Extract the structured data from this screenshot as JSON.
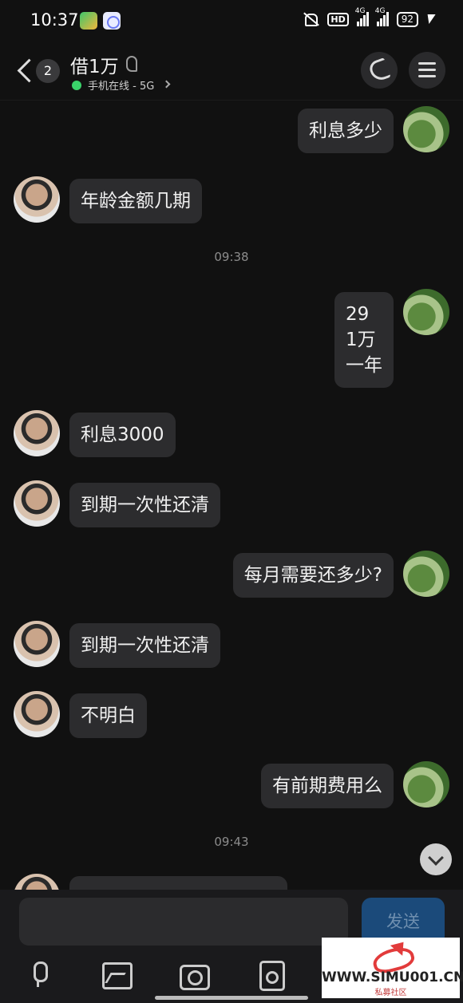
{
  "status_bar": {
    "time": "10:37",
    "hd": "HD",
    "network1": "4G",
    "network2": "4G",
    "battery": "92"
  },
  "header": {
    "unread_count": "2",
    "contact_name": "借1万",
    "online_status": "手机在线 - 5G"
  },
  "messages": [
    {
      "from": "me",
      "text": "利息多少"
    },
    {
      "from": "them",
      "text": "年龄金额几期"
    },
    {
      "timestamp": "09:38"
    },
    {
      "from": "me",
      "text": "29\n1万\n一年"
    },
    {
      "from": "them",
      "text": "利息3000"
    },
    {
      "from": "them",
      "text": "到期一次性还清"
    },
    {
      "from": "me",
      "text": "每月需要还多少?"
    },
    {
      "from": "them",
      "text": "到期一次性还清"
    },
    {
      "from": "them",
      "text": "不明白"
    },
    {
      "from": "me",
      "text": "有前期费用么"
    },
    {
      "timestamp": "09:43"
    },
    {
      "from": "them",
      "text": ""
    }
  ],
  "composer": {
    "input_value": "",
    "send_label": "发送"
  },
  "toolbar": {
    "icons": [
      "mic-icon",
      "image-icon",
      "camera-icon",
      "red-packet-icon"
    ]
  },
  "watermark": {
    "site": "WWW.SIMU001.CN",
    "subtitle": "私募社区"
  }
}
